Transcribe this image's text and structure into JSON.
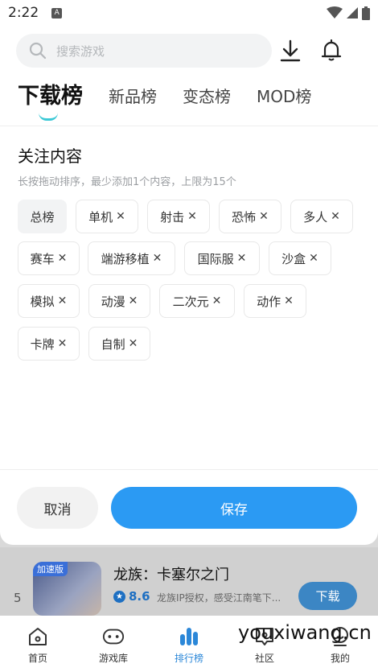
{
  "status_bar": {
    "time": "2:22",
    "indicator": "A"
  },
  "search": {
    "placeholder": "搜索游戏"
  },
  "tabs": [
    {
      "label": "下载榜",
      "active": true
    },
    {
      "label": "新品榜"
    },
    {
      "label": "变态榜"
    },
    {
      "label": "MOD榜"
    }
  ],
  "follow": {
    "title": "关注内容",
    "hint": "长按拖动排序，最少添加1个内容，上限为15个"
  },
  "chips": [
    {
      "label": "总榜",
      "removable": false
    },
    {
      "label": "单机",
      "removable": true
    },
    {
      "label": "射击",
      "removable": true
    },
    {
      "label": "恐怖",
      "removable": true
    },
    {
      "label": "多人",
      "removable": true
    },
    {
      "label": "赛车",
      "removable": true
    },
    {
      "label": "端游移植",
      "removable": true
    },
    {
      "label": "国际服",
      "removable": true
    },
    {
      "label": "沙盒",
      "removable": true
    },
    {
      "label": "模拟",
      "removable": true
    },
    {
      "label": "动漫",
      "removable": true
    },
    {
      "label": "二次元",
      "removable": true
    },
    {
      "label": "动作",
      "removable": true
    },
    {
      "label": "卡牌",
      "removable": true
    },
    {
      "label": "自制",
      "removable": true
    }
  ],
  "remove_glyph": "✕",
  "actions": {
    "cancel": "取消",
    "save": "保存"
  },
  "list_item": {
    "rank": "5",
    "badge": "加速版",
    "name": "龙族：卡塞尔之门",
    "score": "8.6",
    "desc": "龙族IP授权，感受江南笔下...",
    "download": "下载"
  },
  "bottom_nav": [
    {
      "label": "首页",
      "icon": "home-icon"
    },
    {
      "label": "游戏库",
      "icon": "gamepad-icon"
    },
    {
      "label": "排行榜",
      "icon": "ranking-icon",
      "active": true
    },
    {
      "label": "社区",
      "icon": "community-icon"
    },
    {
      "label": "我的",
      "icon": "profile-icon"
    }
  ],
  "watermark": "youxiwang.cn",
  "colors": {
    "accent": "#2b9af3",
    "tab_indicator": "#3cc9d6",
    "nav_active": "#2b87d8"
  }
}
